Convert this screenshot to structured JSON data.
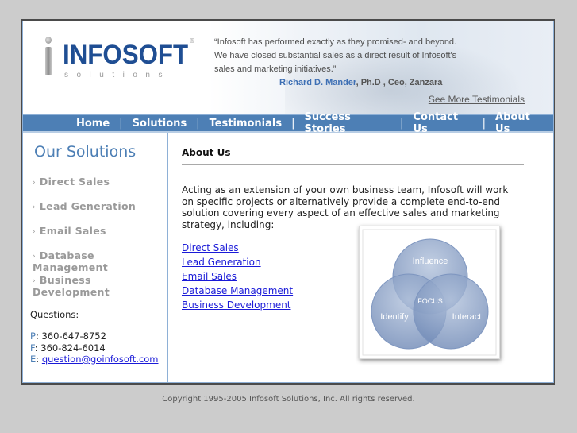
{
  "header": {
    "logo": {
      "name": "INFOSOFT",
      "tagline": "solutions",
      "registered": "®"
    },
    "testimonial": {
      "quote": "“Infosoft has performed exactly as they promised- and beyond. We have closed substantial sales as a direct result of Infosoft's sales and marketing initiatives.”",
      "quote_lines": [
        "“Infosoft has performed exactly as they promised- and beyond.",
        "We have closed substantial sales as a direct result of Infosoft's",
        "sales and marketing initiatives.”"
      ],
      "author_name": "Richard D. Mander",
      "author_title": ", Ph.D , Ceo, Zanzara"
    },
    "more_link": "See More Testimonials"
  },
  "nav": {
    "items": [
      "Home",
      "Solutions",
      "Testimonials",
      "Success Stories",
      "Contact Us",
      "About Us"
    ],
    "separator": "|"
  },
  "sidebar": {
    "title": "Our Solutions",
    "items": [
      {
        "label": "Direct Sales"
      },
      {
        "label": "Lead Generation"
      },
      {
        "label": "Email Sales"
      },
      {
        "label": "Database Management"
      },
      {
        "label": "Business Development"
      }
    ],
    "bullet": "›",
    "questions_label": "Questions:",
    "contact": {
      "phone_key": "P",
      "phone": "360-647-8752",
      "fax_key": "F",
      "fax": "360-824-6014",
      "email_key": "E",
      "email": "question@goinfosoft.com"
    }
  },
  "main": {
    "title": "About Us",
    "body": "Acting as an extension of your own business team, Infosoft will work on specific projects or alternatively provide a complete end-to-end solution covering every aspect of an effective sales and marketing strategy, including:",
    "links": [
      "Direct Sales",
      "Lead Generation",
      "Email Sales",
      "Database Management",
      "Business Development"
    ],
    "venn": {
      "circles": [
        "Influence",
        "Identify",
        "Interact"
      ],
      "center": "FOCUS"
    }
  },
  "footer": {
    "copyright": "Copyright 1995-2005 Infosoft Solutions, Inc. All rights reserved."
  },
  "colors": {
    "brand": "#1f4e93",
    "nav_bg": "#4d7fb5",
    "link": "#1a1ad8",
    "page_bg": "#cccccc"
  }
}
